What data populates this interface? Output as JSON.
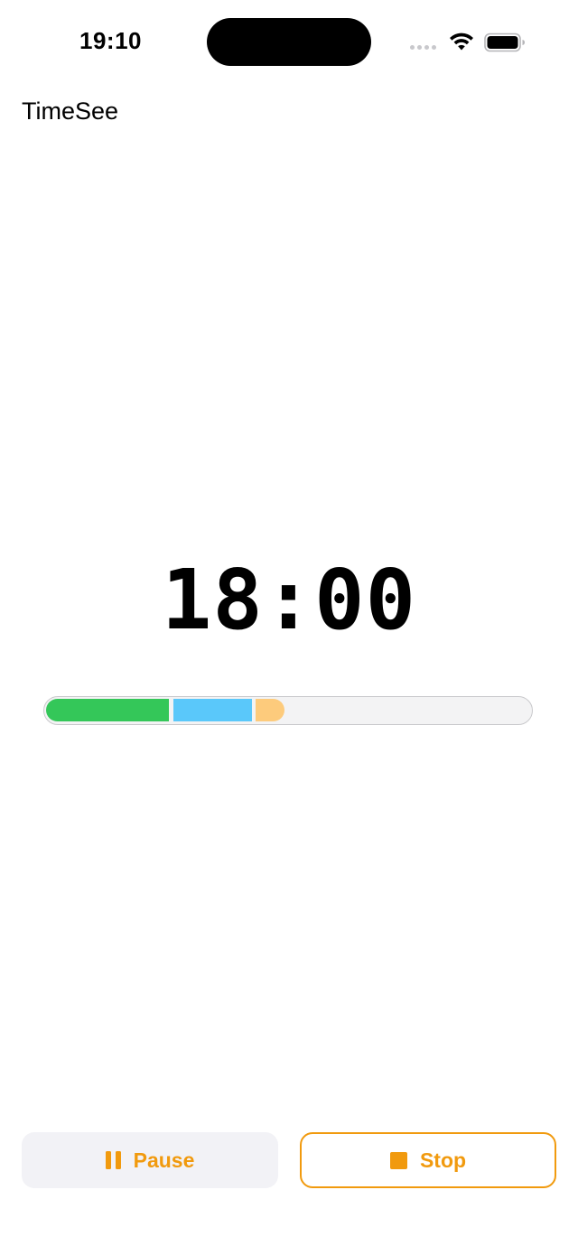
{
  "status_bar": {
    "time": "19:10",
    "wifi_icon": "wifi-icon",
    "battery_icon": "battery-icon",
    "signal_icon": "cellular-signal-icon"
  },
  "app": {
    "title": "TimeSee"
  },
  "timer": {
    "display": "18:00"
  },
  "progress": {
    "segments": [
      {
        "color": "#34c759",
        "fraction": 0.17
      },
      {
        "color": "#5ac8fa",
        "fraction": 0.17
      },
      {
        "color": "#fdcb7c",
        "fraction": 0.06
      }
    ],
    "track_color": "#f3f3f4"
  },
  "controls": {
    "pause_label": "Pause",
    "pause_icon": "pause-icon",
    "stop_label": "Stop",
    "stop_icon": "stop-icon",
    "accent_color": "#f19a0e"
  }
}
